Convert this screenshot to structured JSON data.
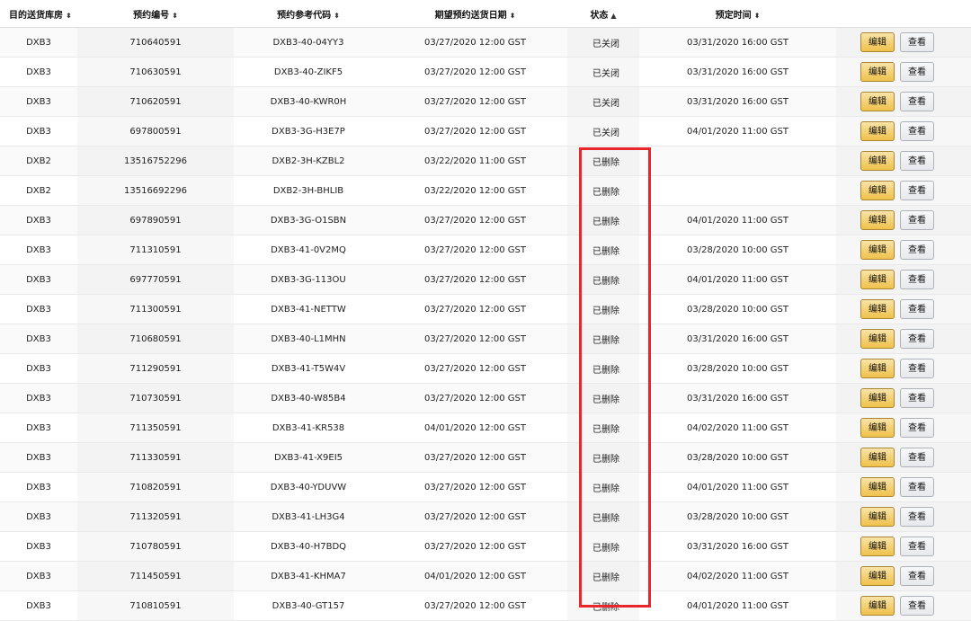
{
  "table": {
    "headers": [
      {
        "label": "目的送货库房",
        "sort": "⬍"
      },
      {
        "label": "预约编号",
        "sort": "⬍"
      },
      {
        "label": "预约参考代码",
        "sort": "⬍"
      },
      {
        "label": "期望预约送货日期",
        "sort": "⬍"
      },
      {
        "label": "状态",
        "sort": "▲"
      },
      {
        "label": "预定时间",
        "sort": "⬍"
      },
      {
        "label": "",
        "sort": ""
      }
    ],
    "edit_label": "编辑",
    "view_label": "查看",
    "rows": [
      {
        "warehouse": "DXB3",
        "id": "710640591",
        "ref": "DXB3-40-04YY3",
        "expected": "03/27/2020 12:00 GST",
        "status": "已关闭",
        "scheduled": "03/31/2020 16:00 GST"
      },
      {
        "warehouse": "DXB3",
        "id": "710630591",
        "ref": "DXB3-40-ZIKF5",
        "expected": "03/27/2020 12:00 GST",
        "status": "已关闭",
        "scheduled": "03/31/2020 16:00 GST"
      },
      {
        "warehouse": "DXB3",
        "id": "710620591",
        "ref": "DXB3-40-KWR0H",
        "expected": "03/27/2020 12:00 GST",
        "status": "已关闭",
        "scheduled": "03/31/2020 16:00 GST"
      },
      {
        "warehouse": "DXB3",
        "id": "697800591",
        "ref": "DXB3-3G-H3E7P",
        "expected": "03/27/2020 12:00 GST",
        "status": "已关闭",
        "scheduled": "04/01/2020 11:00 GST"
      },
      {
        "warehouse": "DXB2",
        "id": "13516752296",
        "ref": "DXB2-3H-KZBL2",
        "expected": "03/22/2020 11:00 GST",
        "status": "已删除",
        "scheduled": ""
      },
      {
        "warehouse": "DXB2",
        "id": "13516692296",
        "ref": "DXB2-3H-BHLIB",
        "expected": "03/22/2020 12:00 GST",
        "status": "已删除",
        "scheduled": ""
      },
      {
        "warehouse": "DXB3",
        "id": "697890591",
        "ref": "DXB3-3G-O1SBN",
        "expected": "03/27/2020 12:00 GST",
        "status": "已删除",
        "scheduled": "04/01/2020 11:00 GST"
      },
      {
        "warehouse": "DXB3",
        "id": "711310591",
        "ref": "DXB3-41-0V2MQ",
        "expected": "03/27/2020 12:00 GST",
        "status": "已删除",
        "scheduled": "03/28/2020 10:00 GST"
      },
      {
        "warehouse": "DXB3",
        "id": "697770591",
        "ref": "DXB3-3G-113OU",
        "expected": "03/27/2020 12:00 GST",
        "status": "已删除",
        "scheduled": "04/01/2020 11:00 GST"
      },
      {
        "warehouse": "DXB3",
        "id": "711300591",
        "ref": "DXB3-41-NETTW",
        "expected": "03/27/2020 12:00 GST",
        "status": "已删除",
        "scheduled": "03/28/2020 10:00 GST"
      },
      {
        "warehouse": "DXB3",
        "id": "710680591",
        "ref": "DXB3-40-L1MHN",
        "expected": "03/27/2020 12:00 GST",
        "status": "已删除",
        "scheduled": "03/31/2020 16:00 GST"
      },
      {
        "warehouse": "DXB3",
        "id": "711290591",
        "ref": "DXB3-41-T5W4V",
        "expected": "03/27/2020 12:00 GST",
        "status": "已删除",
        "scheduled": "03/28/2020 10:00 GST"
      },
      {
        "warehouse": "DXB3",
        "id": "710730591",
        "ref": "DXB3-40-W85B4",
        "expected": "03/27/2020 12:00 GST",
        "status": "已删除",
        "scheduled": "03/31/2020 16:00 GST"
      },
      {
        "warehouse": "DXB3",
        "id": "711350591",
        "ref": "DXB3-41-KR538",
        "expected": "04/01/2020 12:00 GST",
        "status": "已删除",
        "scheduled": "04/02/2020 11:00 GST"
      },
      {
        "warehouse": "DXB3",
        "id": "711330591",
        "ref": "DXB3-41-X9EI5",
        "expected": "03/27/2020 12:00 GST",
        "status": "已删除",
        "scheduled": "03/28/2020 10:00 GST"
      },
      {
        "warehouse": "DXB3",
        "id": "710820591",
        "ref": "DXB3-40-YDUVW",
        "expected": "03/27/2020 12:00 GST",
        "status": "已删除",
        "scheduled": "04/01/2020 11:00 GST"
      },
      {
        "warehouse": "DXB3",
        "id": "711320591",
        "ref": "DXB3-41-LH3G4",
        "expected": "03/27/2020 12:00 GST",
        "status": "已删除",
        "scheduled": "03/28/2020 10:00 GST"
      },
      {
        "warehouse": "DXB3",
        "id": "710780591",
        "ref": "DXB3-40-H7BDQ",
        "expected": "03/27/2020 12:00 GST",
        "status": "已删除",
        "scheduled": "03/31/2020 16:00 GST"
      },
      {
        "warehouse": "DXB3",
        "id": "711450591",
        "ref": "DXB3-41-KHMA7",
        "expected": "04/01/2020 12:00 GST",
        "status": "已删除",
        "scheduled": "04/02/2020 11:00 GST"
      },
      {
        "warehouse": "DXB3",
        "id": "710810591",
        "ref": "DXB3-40-GT157",
        "expected": "03/27/2020 12:00 GST",
        "status": "已删除",
        "scheduled": "04/01/2020 11:00 GST"
      }
    ]
  },
  "colors": {
    "edit_button": "#f0c14b",
    "view_button": "#e7e9ec",
    "highlight": "#e8262b"
  }
}
